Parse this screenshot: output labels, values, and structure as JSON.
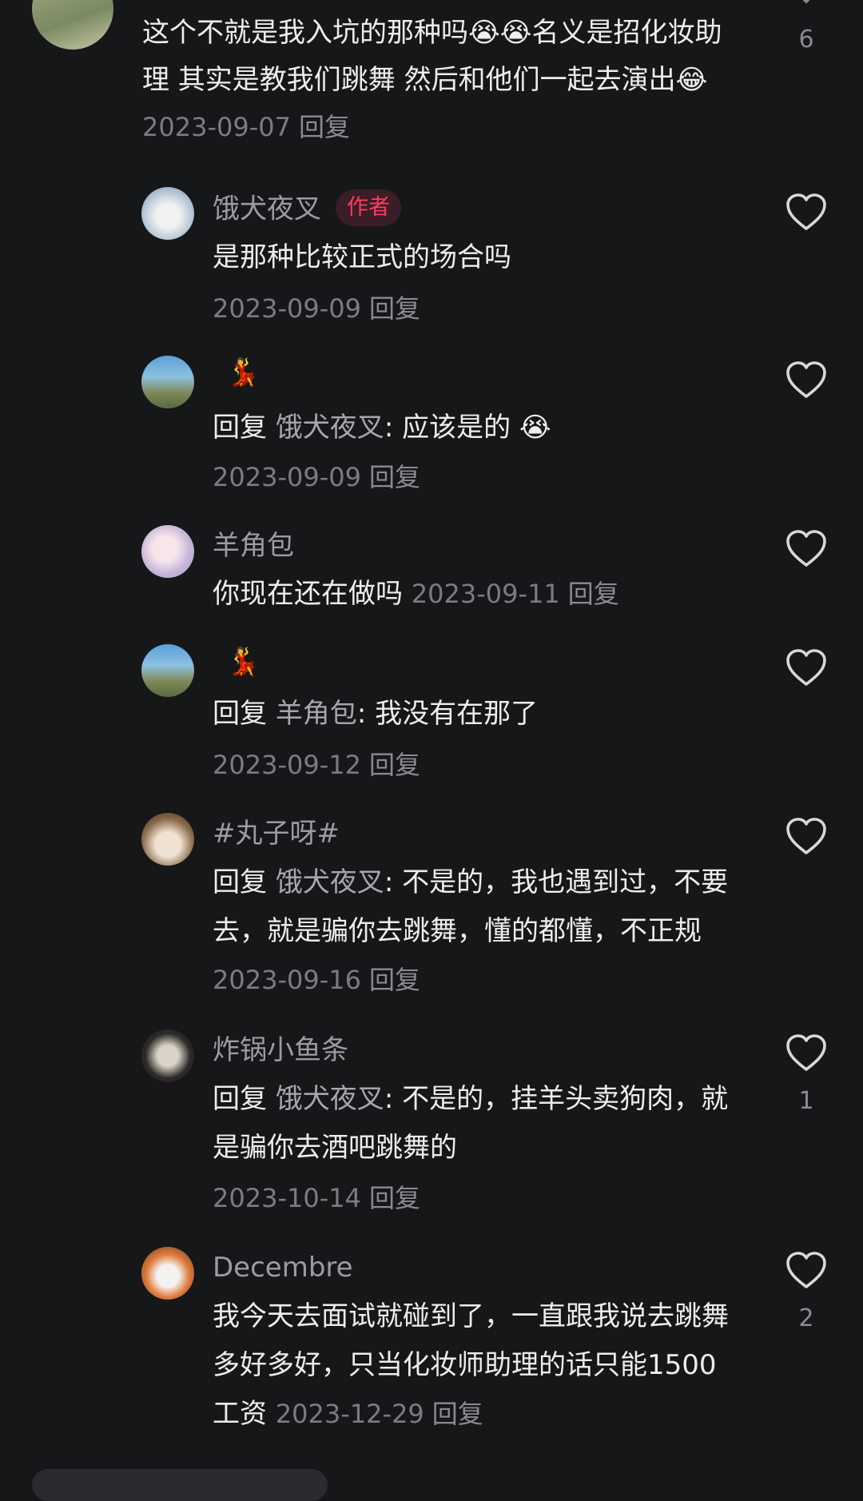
{
  "reply_label": "回复",
  "top_comment": {
    "text": "这个不就是我入坑的那种吗😭😭名义是招化妆助理 其实是教我们跳舞 然后和他们一起去演出😂",
    "date": "2023-09-07",
    "like_count": "6"
  },
  "replies": [
    {
      "user": "饿犬夜叉",
      "badge": "作者",
      "text": "是那种比较正式的场合吗",
      "date": "2023-09-09"
    },
    {
      "user": "💃",
      "reply_to": "饿犬夜叉",
      "text": "应该是的 😭",
      "date": "2023-09-09"
    },
    {
      "user": "羊角包",
      "text": "你现在还在做吗",
      "date": "2023-09-11"
    },
    {
      "user": "💃",
      "reply_to": "羊角包",
      "text": "我没有在那了",
      "date": "2023-09-12"
    },
    {
      "user": "#丸子呀#",
      "reply_to": "饿犬夜叉",
      "text": "不是的，我也遇到过，不要去，就是骗你去跳舞，懂的都懂，不正规",
      "date": "2023-09-16"
    },
    {
      "user": "炸锅小鱼条",
      "reply_to": "饿犬夜叉",
      "text": "不是的，挂羊头卖狗肉，就是骗你去酒吧跳舞的",
      "date": "2023-10-14",
      "like_count": "1"
    },
    {
      "user": "Decembre",
      "text": "我今天去面试就碰到了，一直跟我说去跳舞多好多好，只当化妆师助理的话只能1500工资",
      "date": "2023-12-29",
      "like_count": "2"
    }
  ]
}
